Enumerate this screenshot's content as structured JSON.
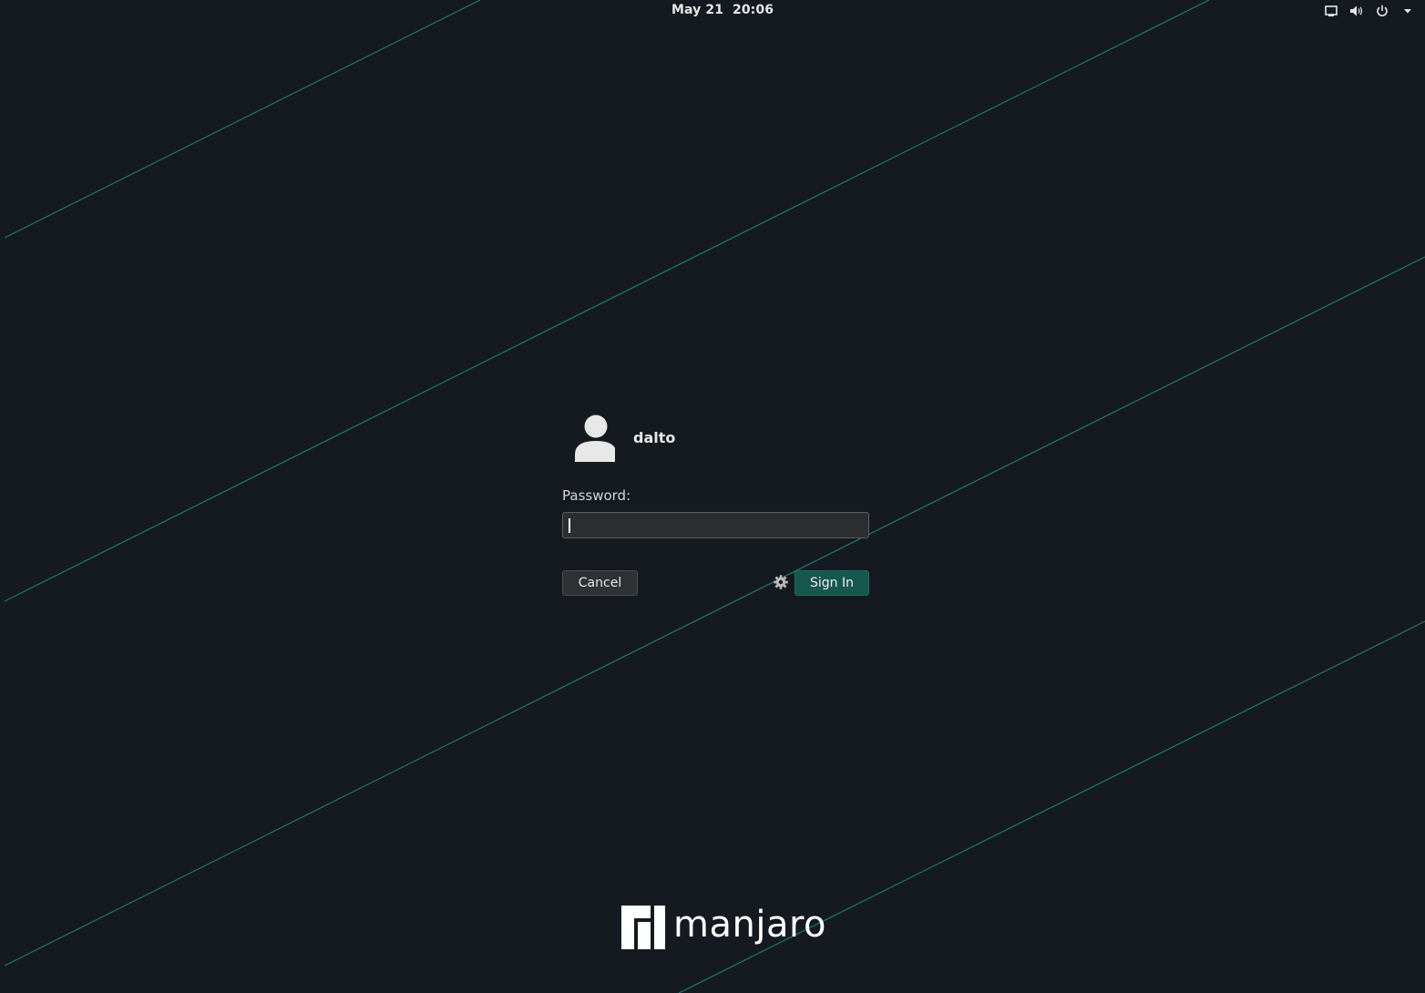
{
  "topbar": {
    "clock": "May 21  20:06",
    "tray_icons": [
      "display-icon",
      "volume-icon",
      "power-icon",
      "chevron-down-icon"
    ]
  },
  "login": {
    "username": "dalto",
    "password_label": "Password:",
    "password_value": "",
    "cancel_label": "Cancel",
    "signin_label": "Sign In",
    "avatar_icon": "user-avatar-icon",
    "session_icon": "gear-icon"
  },
  "branding": {
    "logo_text": "manjaro"
  },
  "colors": {
    "background": "#141a1f",
    "accent_line": "#1f8f7f",
    "signin_button": "#16574e"
  }
}
